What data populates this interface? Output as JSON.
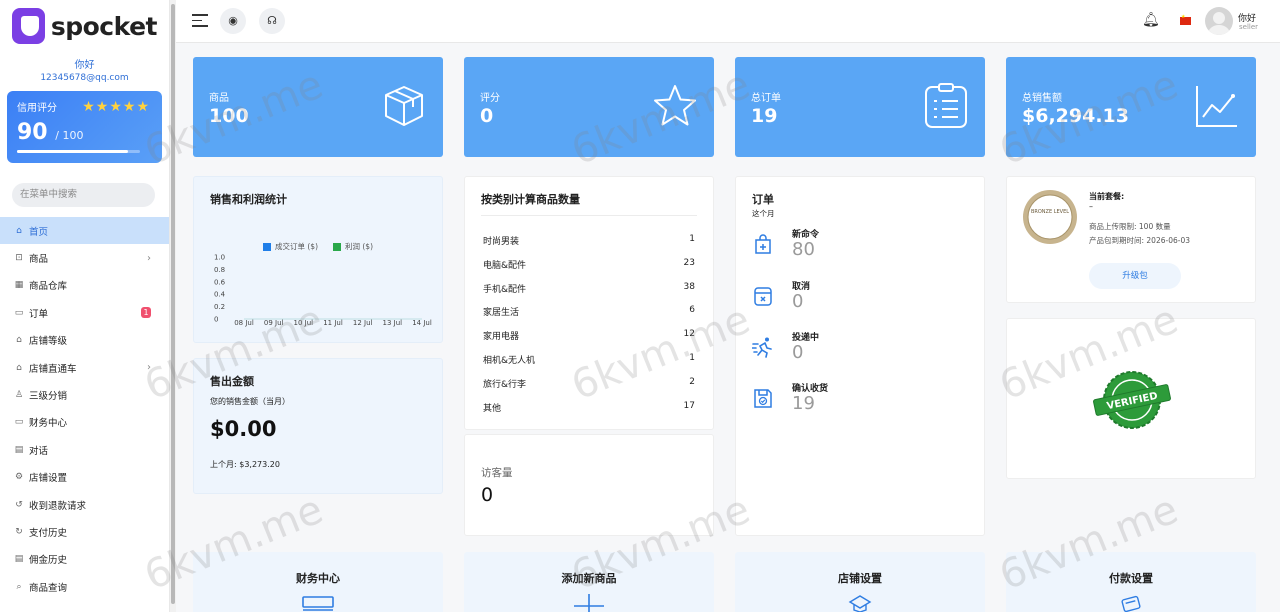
{
  "brand": {
    "name": "spocket"
  },
  "user": {
    "name": "你好",
    "email": "12345678@qq.com",
    "role": "seller"
  },
  "credit": {
    "label": "信用评分",
    "stars": "★★★★★",
    "score": "90",
    "max": "/ 100",
    "progress_fraction": 0.9
  },
  "search": {
    "placeholder": "在菜单中搜索"
  },
  "menu": [
    {
      "label": "首页",
      "icon": "home-icon",
      "glyph": "⌂",
      "active": true
    },
    {
      "label": "商品",
      "icon": "shopping-bag-icon",
      "glyph": "⊡",
      "arrow": "›"
    },
    {
      "label": "商品仓库",
      "icon": "warehouse-icon",
      "glyph": "▦"
    },
    {
      "label": "订单",
      "icon": "order-icon",
      "glyph": "▭",
      "badge": "1"
    },
    {
      "label": "店铺等级",
      "icon": "store-icon",
      "glyph": "⌂"
    },
    {
      "label": "店铺直通车",
      "icon": "store-promo-icon",
      "glyph": "⌂",
      "arrow": "›"
    },
    {
      "label": "三级分销",
      "icon": "users-icon",
      "glyph": "♙"
    },
    {
      "label": "财务中心",
      "icon": "finance-icon",
      "glyph": "▭"
    },
    {
      "label": "对话",
      "icon": "chat-icon",
      "glyph": "▤"
    },
    {
      "label": "店铺设置",
      "icon": "settings-icon",
      "glyph": "⚙"
    },
    {
      "label": "收到退款请求",
      "icon": "refund-icon",
      "glyph": "↺"
    },
    {
      "label": "支付历史",
      "icon": "history-icon",
      "glyph": "↻"
    },
    {
      "label": "佣金历史",
      "icon": "commission-icon",
      "glyph": "▤"
    },
    {
      "label": "商品查询",
      "icon": "query-icon",
      "glyph": "⌕"
    }
  ],
  "stats": [
    {
      "label": "商品",
      "value": "100",
      "icon": "box-icon"
    },
    {
      "label": "评分",
      "value": "0",
      "icon": "star-icon"
    },
    {
      "label": "总订单",
      "value": "19",
      "icon": "clipboard-icon"
    },
    {
      "label": "总销售额",
      "value": "$6,294.13",
      "icon": "trend-chart-icon"
    }
  ],
  "sales_chart": {
    "title": "销售和利润统计",
    "legend": [
      {
        "name": "成交订单 ($)",
        "color": "#1f7ee8"
      },
      {
        "name": "利润 ($)",
        "color": "#2aa84a"
      }
    ],
    "yticks": [
      "1.0",
      "0.8",
      "0.6",
      "0.4",
      "0.2",
      "0"
    ],
    "xticks": [
      "08 Jul",
      "09 Jul",
      "10 Jul",
      "11 Jul",
      "12 Jul",
      "13 Jul",
      "14 Jul"
    ]
  },
  "chart_data": {
    "type": "line",
    "title": "",
    "categories": [
      "08 Jul",
      "09 Jul",
      "10 Jul",
      "11 Jul",
      "12 Jul",
      "13 Jul",
      "14 Jul"
    ],
    "series": [
      {
        "name": "成交订单 ($)",
        "values": [
          0,
          0,
          0,
          0,
          0,
          0,
          0
        ]
      },
      {
        "name": "利润 ($)",
        "values": [
          0,
          0,
          0,
          0,
          0,
          0,
          0
        ]
      }
    ],
    "ylim": [
      0,
      1.0
    ],
    "legend_position": "top"
  },
  "category_panel": {
    "title": "按类别计算商品数量",
    "rows": [
      {
        "name": "时尚男装",
        "count": "1"
      },
      {
        "name": "电脑&配件",
        "count": "23"
      },
      {
        "name": "手机&配件",
        "count": "38"
      },
      {
        "name": "家居生活",
        "count": "6"
      },
      {
        "name": "家用电器",
        "count": "12"
      },
      {
        "name": "相机&无人机",
        "count": "1"
      },
      {
        "name": "旅行&行李",
        "count": "2"
      },
      {
        "name": "其他",
        "count": "17"
      }
    ]
  },
  "orders_panel": {
    "title": "订单",
    "subtitle": "这个月",
    "items": [
      {
        "label": "新命令",
        "value": "80",
        "icon": "new-order-icon"
      },
      {
        "label": "取消",
        "value": "0",
        "icon": "cancel-order-icon"
      },
      {
        "label": "投递中",
        "value": "0",
        "icon": "delivery-icon"
      },
      {
        "label": "确认收货",
        "value": "19",
        "icon": "confirm-receipt-icon"
      }
    ]
  },
  "plan_panel": {
    "label": "当前套餐:",
    "plan": "–",
    "limit": "商品上传限制: 100 数量",
    "expiry": "产品包到期时间: 2026-06-03",
    "upgrade": "升级包",
    "badge_text": "BRONZE LEVEL"
  },
  "verified": {
    "text": "VERIFIED"
  },
  "sales_amount": {
    "title": "售出金额",
    "subtitle": "您的销售金额（当月）",
    "value": "$0.00",
    "last_month": "上个月: $3,273.20"
  },
  "visitors": {
    "label": "访客量",
    "value": "0"
  },
  "quick_links": [
    {
      "label": "财务中心",
      "icon": "finance-center-icon"
    },
    {
      "label": "添加新商品",
      "icon": "add-product-icon"
    },
    {
      "label": "店铺设置",
      "icon": "store-settings-icon"
    },
    {
      "label": "付款设置",
      "icon": "payment-settings-icon"
    }
  ],
  "watermark": "6kvm.me",
  "colors": {
    "accent": "#5aa6f5",
    "active_menu": "#c9e0fb",
    "brand": "#7b3fe4",
    "badge": "#f0506e"
  }
}
